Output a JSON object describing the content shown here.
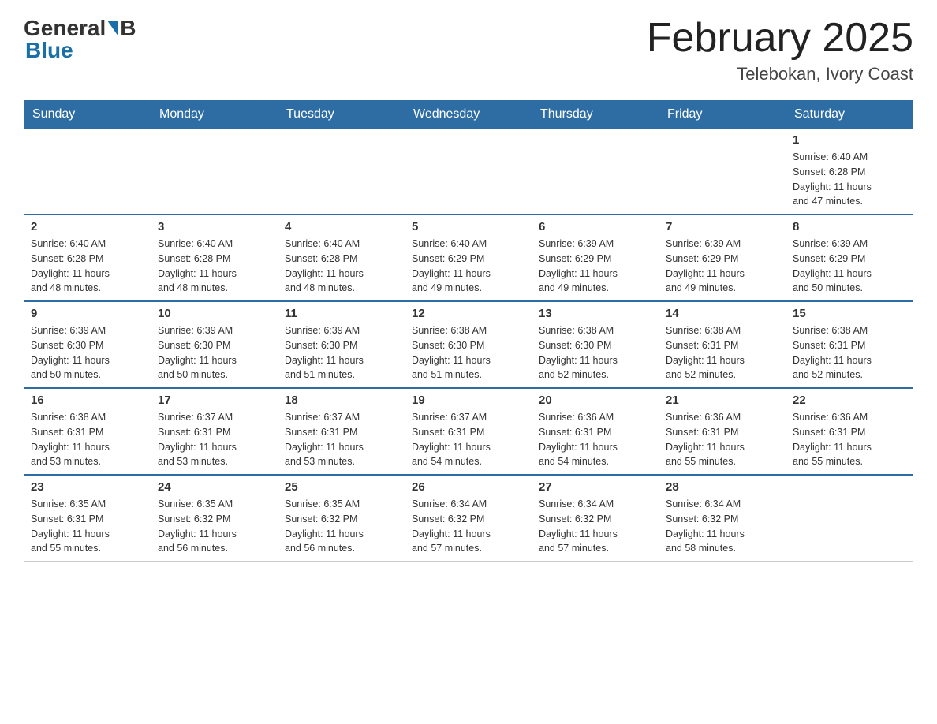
{
  "header": {
    "logo": {
      "general": "General",
      "blue": "Blue"
    },
    "title": "February 2025",
    "location": "Telebokan, Ivory Coast"
  },
  "weekdays": [
    "Sunday",
    "Monday",
    "Tuesday",
    "Wednesday",
    "Thursday",
    "Friday",
    "Saturday"
  ],
  "weeks": [
    [
      {
        "day": "",
        "info": ""
      },
      {
        "day": "",
        "info": ""
      },
      {
        "day": "",
        "info": ""
      },
      {
        "day": "",
        "info": ""
      },
      {
        "day": "",
        "info": ""
      },
      {
        "day": "",
        "info": ""
      },
      {
        "day": "1",
        "info": "Sunrise: 6:40 AM\nSunset: 6:28 PM\nDaylight: 11 hours\nand 47 minutes."
      }
    ],
    [
      {
        "day": "2",
        "info": "Sunrise: 6:40 AM\nSunset: 6:28 PM\nDaylight: 11 hours\nand 48 minutes."
      },
      {
        "day": "3",
        "info": "Sunrise: 6:40 AM\nSunset: 6:28 PM\nDaylight: 11 hours\nand 48 minutes."
      },
      {
        "day": "4",
        "info": "Sunrise: 6:40 AM\nSunset: 6:28 PM\nDaylight: 11 hours\nand 48 minutes."
      },
      {
        "day": "5",
        "info": "Sunrise: 6:40 AM\nSunset: 6:29 PM\nDaylight: 11 hours\nand 49 minutes."
      },
      {
        "day": "6",
        "info": "Sunrise: 6:39 AM\nSunset: 6:29 PM\nDaylight: 11 hours\nand 49 minutes."
      },
      {
        "day": "7",
        "info": "Sunrise: 6:39 AM\nSunset: 6:29 PM\nDaylight: 11 hours\nand 49 minutes."
      },
      {
        "day": "8",
        "info": "Sunrise: 6:39 AM\nSunset: 6:29 PM\nDaylight: 11 hours\nand 50 minutes."
      }
    ],
    [
      {
        "day": "9",
        "info": "Sunrise: 6:39 AM\nSunset: 6:30 PM\nDaylight: 11 hours\nand 50 minutes."
      },
      {
        "day": "10",
        "info": "Sunrise: 6:39 AM\nSunset: 6:30 PM\nDaylight: 11 hours\nand 50 minutes."
      },
      {
        "day": "11",
        "info": "Sunrise: 6:39 AM\nSunset: 6:30 PM\nDaylight: 11 hours\nand 51 minutes."
      },
      {
        "day": "12",
        "info": "Sunrise: 6:38 AM\nSunset: 6:30 PM\nDaylight: 11 hours\nand 51 minutes."
      },
      {
        "day": "13",
        "info": "Sunrise: 6:38 AM\nSunset: 6:30 PM\nDaylight: 11 hours\nand 52 minutes."
      },
      {
        "day": "14",
        "info": "Sunrise: 6:38 AM\nSunset: 6:31 PM\nDaylight: 11 hours\nand 52 minutes."
      },
      {
        "day": "15",
        "info": "Sunrise: 6:38 AM\nSunset: 6:31 PM\nDaylight: 11 hours\nand 52 minutes."
      }
    ],
    [
      {
        "day": "16",
        "info": "Sunrise: 6:38 AM\nSunset: 6:31 PM\nDaylight: 11 hours\nand 53 minutes."
      },
      {
        "day": "17",
        "info": "Sunrise: 6:37 AM\nSunset: 6:31 PM\nDaylight: 11 hours\nand 53 minutes."
      },
      {
        "day": "18",
        "info": "Sunrise: 6:37 AM\nSunset: 6:31 PM\nDaylight: 11 hours\nand 53 minutes."
      },
      {
        "day": "19",
        "info": "Sunrise: 6:37 AM\nSunset: 6:31 PM\nDaylight: 11 hours\nand 54 minutes."
      },
      {
        "day": "20",
        "info": "Sunrise: 6:36 AM\nSunset: 6:31 PM\nDaylight: 11 hours\nand 54 minutes."
      },
      {
        "day": "21",
        "info": "Sunrise: 6:36 AM\nSunset: 6:31 PM\nDaylight: 11 hours\nand 55 minutes."
      },
      {
        "day": "22",
        "info": "Sunrise: 6:36 AM\nSunset: 6:31 PM\nDaylight: 11 hours\nand 55 minutes."
      }
    ],
    [
      {
        "day": "23",
        "info": "Sunrise: 6:35 AM\nSunset: 6:31 PM\nDaylight: 11 hours\nand 55 minutes."
      },
      {
        "day": "24",
        "info": "Sunrise: 6:35 AM\nSunset: 6:32 PM\nDaylight: 11 hours\nand 56 minutes."
      },
      {
        "day": "25",
        "info": "Sunrise: 6:35 AM\nSunset: 6:32 PM\nDaylight: 11 hours\nand 56 minutes."
      },
      {
        "day": "26",
        "info": "Sunrise: 6:34 AM\nSunset: 6:32 PM\nDaylight: 11 hours\nand 57 minutes."
      },
      {
        "day": "27",
        "info": "Sunrise: 6:34 AM\nSunset: 6:32 PM\nDaylight: 11 hours\nand 57 minutes."
      },
      {
        "day": "28",
        "info": "Sunrise: 6:34 AM\nSunset: 6:32 PM\nDaylight: 11 hours\nand 58 minutes."
      },
      {
        "day": "",
        "info": ""
      }
    ]
  ]
}
